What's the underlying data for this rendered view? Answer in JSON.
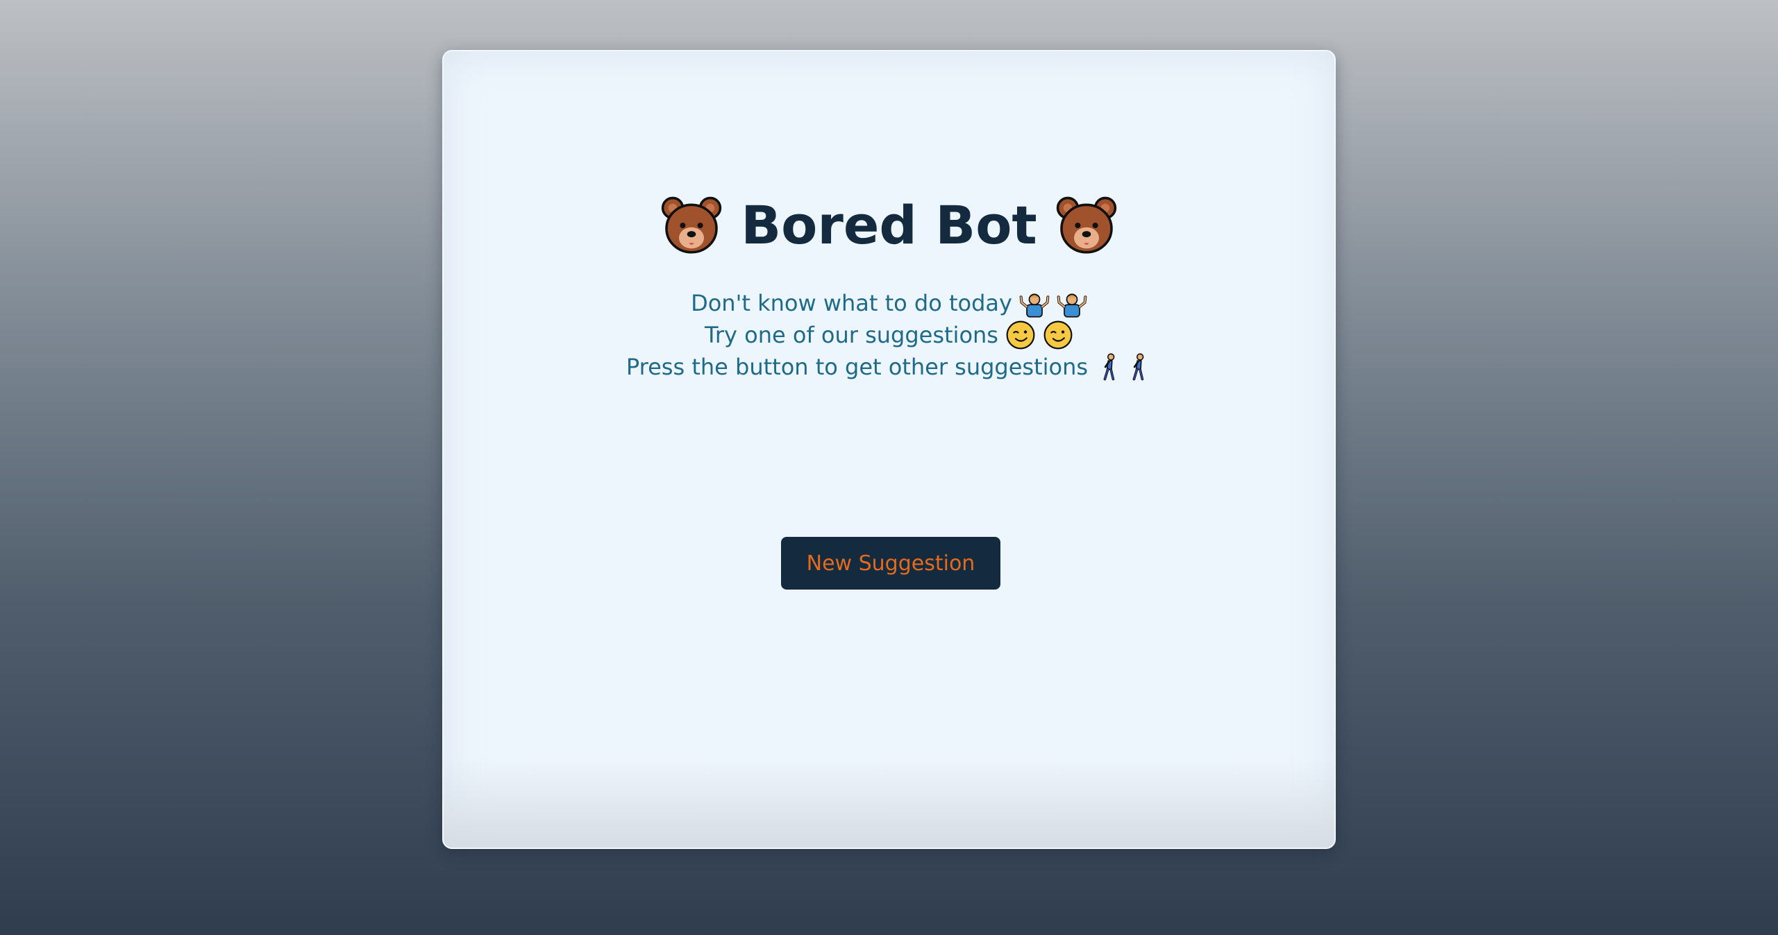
{
  "app": {
    "title": "Bored Bot",
    "title_icon": "bear-face-icon"
  },
  "intro": {
    "lines": [
      {
        "text": "Don't know what to do today",
        "icon": "person-shrugging-icon"
      },
      {
        "text": "Try one of our suggestions",
        "icon": "winking-face-icon"
      },
      {
        "text": "Press the button to get other suggestions",
        "icon": "person-walking-icon"
      }
    ]
  },
  "actions": {
    "new_suggestion_label": "New Suggestion"
  },
  "colors": {
    "title": "#142a3f",
    "intro_text": "#1f6a8a",
    "button_bg": "#142a3f",
    "button_text": "#e46a1c",
    "card_bg": "#eef6fd"
  }
}
